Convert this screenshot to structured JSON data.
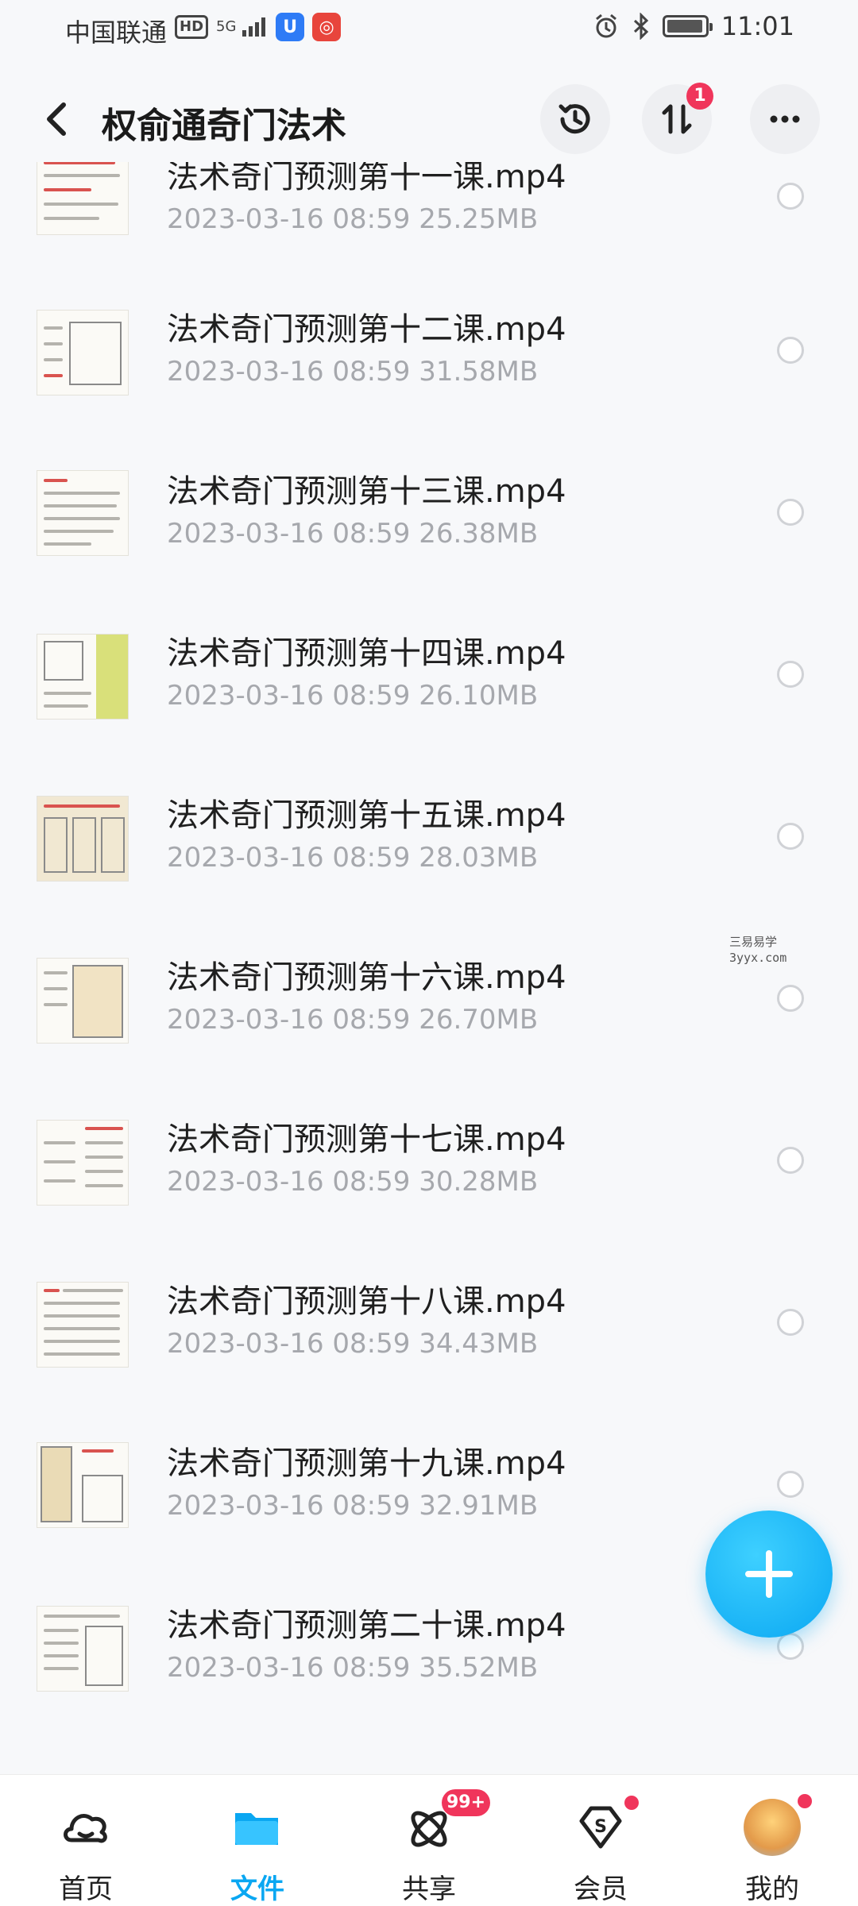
{
  "status_bar": {
    "carrier": "中国联通",
    "hd": "HD",
    "signal": "5G",
    "time": "11:01"
  },
  "header": {
    "title": "权俞通奇门法术",
    "transfer_badge": "1"
  },
  "files": [
    {
      "name": "法术奇门预测第十一课.mp4",
      "date": "2023-03-16  08:59",
      "size": "25.25MB"
    },
    {
      "name": "法术奇门预测第十二课.mp4",
      "date": "2023-03-16  08:59",
      "size": "31.58MB"
    },
    {
      "name": "法术奇门预测第十三课.mp4",
      "date": "2023-03-16  08:59",
      "size": "26.38MB"
    },
    {
      "name": "法术奇门预测第十四课.mp4",
      "date": "2023-03-16  08:59",
      "size": "26.10MB"
    },
    {
      "name": "法术奇门预测第十五课.mp4",
      "date": "2023-03-16  08:59",
      "size": "28.03MB"
    },
    {
      "name": "法术奇门预测第十六课.mp4",
      "date": "2023-03-16  08:59",
      "size": "26.70MB"
    },
    {
      "name": "法术奇门预测第十七课.mp4",
      "date": "2023-03-16  08:59",
      "size": "30.28MB"
    },
    {
      "name": "法术奇门预测第十八课.mp4",
      "date": "2023-03-16  08:59",
      "size": "34.43MB"
    },
    {
      "name": "法术奇门预测第十九课.mp4",
      "date": "2023-03-16  08:59",
      "size": "32.91MB"
    },
    {
      "name": "法术奇门预测第二十课.mp4",
      "date": "2023-03-16  08:59",
      "size": "35.52MB"
    }
  ],
  "watermark": {
    "line1": "三易易学",
    "line2": "3yyx.com"
  },
  "nav": {
    "home": "首页",
    "files": "文件",
    "share": "共享",
    "share_badge": "99+",
    "vip": "会员",
    "me": "我的"
  },
  "colors": {
    "accent": "#0aa7f2",
    "badge": "#f0355b"
  }
}
